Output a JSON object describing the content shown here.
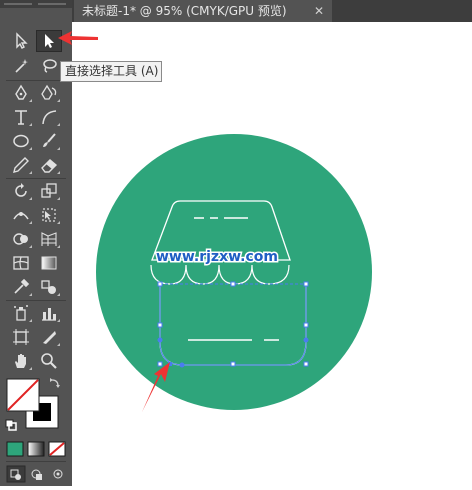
{
  "document_tab": {
    "title": "未标题-1* @ 95% (CMYK/GPU 预览)",
    "close_glyph": "✕"
  },
  "tooltip": {
    "text": "直接选择工具 (A)"
  },
  "watermark": {
    "text": "www.rjzxw.com"
  },
  "colors": {
    "toolbar_bg": "#535353",
    "circle_fill": "#2ea57b",
    "icon_line": "#ffffff",
    "selection": "#4a7cf0",
    "arrow": "#ee3333",
    "watermark_text": "#1f5fc4"
  },
  "tools": [
    "selection-tool-icon",
    "direct-selection-tool-icon",
    "magic-wand-tool-icon",
    "lasso-tool-icon",
    "pen-tool-icon",
    "curvature-tool-icon",
    "type-tool-icon",
    "line-segment-tool-icon",
    "ellipse-tool-icon",
    "paintbrush-tool-icon",
    "pencil-tool-icon",
    "eraser-tool-icon",
    "rotate-tool-icon",
    "scale-tool-icon",
    "width-tool-icon",
    "free-transform-tool-icon",
    "shape-builder-tool-icon",
    "perspective-grid-tool-icon",
    "mesh-tool-icon",
    "gradient-tool-icon",
    "eyedropper-tool-icon",
    "blend-tool-icon",
    "symbol-sprayer-tool-icon",
    "column-graph-tool-icon",
    "artboard-tool-icon",
    "slice-tool-icon",
    "hand-tool-icon",
    "zoom-tool-icon"
  ]
}
